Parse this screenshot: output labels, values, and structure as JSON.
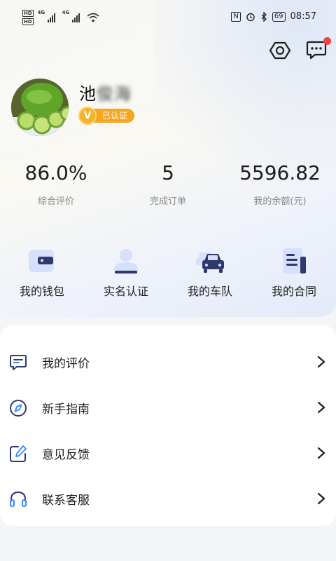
{
  "status_bar": {
    "network_a": "4G",
    "network_b": "4G",
    "hd_a": "HD",
    "hd_b": "HD",
    "nfc": "N",
    "battery": "69",
    "time": "08:57"
  },
  "header": {
    "settings_icon": "settings-hexagon-icon",
    "message_icon": "message-bubble-icon",
    "has_unread": true
  },
  "profile": {
    "name_visible": "池",
    "name_blurred": "俊海",
    "verify_letter": "V",
    "verify_label": "已认证"
  },
  "stats": [
    {
      "value": "86.0%",
      "label": "综合评价"
    },
    {
      "value": "5",
      "label": "完成订单"
    },
    {
      "value": "5596.82",
      "label": "我的余额(元)"
    }
  ],
  "actions": [
    {
      "label": "我的钱包",
      "icon": "wallet-icon"
    },
    {
      "label": "实名认证",
      "icon": "id-verify-icon"
    },
    {
      "label": "我的车队",
      "icon": "fleet-car-icon"
    },
    {
      "label": "我的合同",
      "icon": "contract-icon"
    }
  ],
  "menu": [
    {
      "label": "我的评价",
      "icon": "comment-icon"
    },
    {
      "label": "新手指南",
      "icon": "compass-icon"
    },
    {
      "label": "意见反馈",
      "icon": "edit-feedback-icon"
    },
    {
      "label": "联系客服",
      "icon": "headset-icon"
    }
  ],
  "colors": {
    "accent_navy": "#2d3a6b",
    "accent_light_blue": "#dbe4fb",
    "verify_orange": "#f7a71f",
    "badge_red": "#f0433d"
  }
}
